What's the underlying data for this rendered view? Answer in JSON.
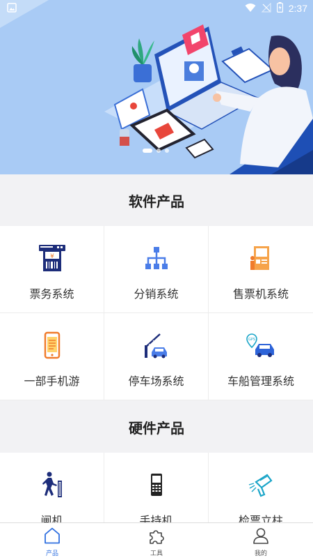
{
  "status_bar": {
    "time": "2:37"
  },
  "banner": {
    "slides": 3,
    "active_slide": 0
  },
  "software": {
    "title": "软件产品",
    "items": [
      {
        "label": "票务系统",
        "icon": "ticket-system-icon"
      },
      {
        "label": "分销系统",
        "icon": "distribution-icon"
      },
      {
        "label": "售票机系统",
        "icon": "ticket-machine-icon"
      },
      {
        "label": "一部手机游",
        "icon": "mobile-travel-icon"
      },
      {
        "label": "停车场系统",
        "icon": "parking-icon"
      },
      {
        "label": "车船管理系统",
        "icon": "vehicle-gps-icon"
      }
    ]
  },
  "hardware": {
    "title": "硬件产品",
    "items": [
      {
        "label": "闸机",
        "icon": "turnstile-icon"
      },
      {
        "label": "手持机",
        "icon": "handheld-icon"
      },
      {
        "label": "检票立柱",
        "icon": "scanner-pillar-icon"
      }
    ]
  },
  "tabbar": {
    "items": [
      {
        "label": "产品",
        "icon": "home-icon",
        "active": true
      },
      {
        "label": "工具",
        "icon": "puzzle-icon",
        "active": false
      },
      {
        "label": "我的",
        "icon": "user-icon",
        "active": false
      }
    ]
  },
  "colors": {
    "accent": "#2f6fe0",
    "banner_bg": "#a9cbf5",
    "navy": "#1d2d7a",
    "orange": "#f07b2b"
  }
}
